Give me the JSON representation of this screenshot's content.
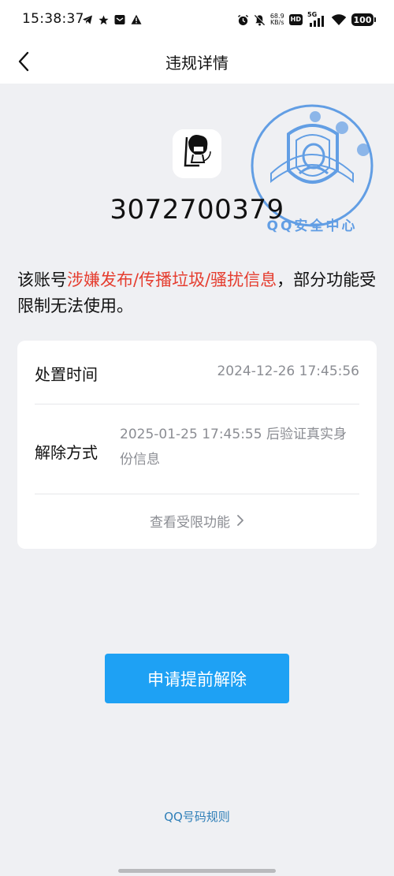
{
  "status_bar": {
    "time": "15:38:37",
    "net_speed_value": "68.9",
    "net_speed_unit": "KB/s",
    "hd_label": "HD",
    "network_type": "5G",
    "battery": "100",
    "left_icons": [
      "telegram-icon",
      "star-icon",
      "mail-icon",
      "warning-icon"
    ],
    "right_icons": [
      "alarm-icon",
      "mute-icon",
      "signal-icon",
      "wifi-icon"
    ]
  },
  "nav": {
    "title": "违规详情",
    "back_icon": "chevron-left-icon"
  },
  "account": {
    "number": "3072700379"
  },
  "stamp": {
    "text": "QQ安全中心"
  },
  "violation": {
    "prefix": "该账号",
    "highlight": "涉嫌发布/传播垃圾/骚扰信息",
    "suffix": "，部分功能受限制无法使用。",
    "highlight_color": "#e53d2f"
  },
  "details": {
    "handling_time_label": "处置时间",
    "handling_time_value": "2024-12-26 17:45:56",
    "release_method_label": "解除方式",
    "release_method_value": "2025-01-25 17:45:55 后验证真实身份信息",
    "view_limits_label": "查看受限功能"
  },
  "actions": {
    "apply_label": "申请提前解除",
    "rules_label": "QQ号码规则"
  },
  "colors": {
    "primary": "#1ea1f4",
    "link": "#2f7fb8",
    "background": "#eff0f3",
    "stamp": "#4a90e2"
  }
}
